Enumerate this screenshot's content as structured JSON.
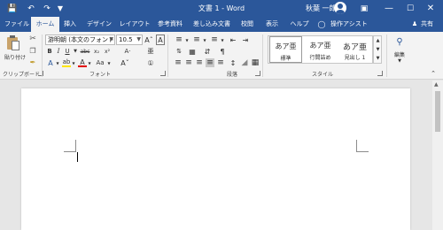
{
  "window": {
    "title": "文書 1  -  Word",
    "user_name": "秋葉 一郎"
  },
  "tabs": [
    "ファイル",
    "ホーム",
    "挿入",
    "デザイン",
    "レイアウト",
    "参考資料",
    "差し込み文書",
    "校閲",
    "表示",
    "ヘルプ"
  ],
  "tell_me": "操作アシスト",
  "share": "共有",
  "clipboard": {
    "paste_label": "貼り付け",
    "group_label": "クリップボード"
  },
  "font": {
    "font_name": "游明朝 (本文のフォント",
    "font_size": "10.5",
    "group_label": "フォント"
  },
  "paragraph": {
    "group_label": "段落"
  },
  "styles": {
    "items": [
      {
        "sample": "あア亜",
        "name": "標準"
      },
      {
        "sample": "あア亜",
        "name": "行間詰め"
      },
      {
        "sample": "あア亜",
        "name": "見出し 1"
      }
    ],
    "group_label": "スタイル"
  },
  "editing": {
    "label": "編集"
  },
  "colors": {
    "brand": "#2b579a",
    "ribbon": "#f3f3f3",
    "canvas": "#e6e6e6"
  }
}
